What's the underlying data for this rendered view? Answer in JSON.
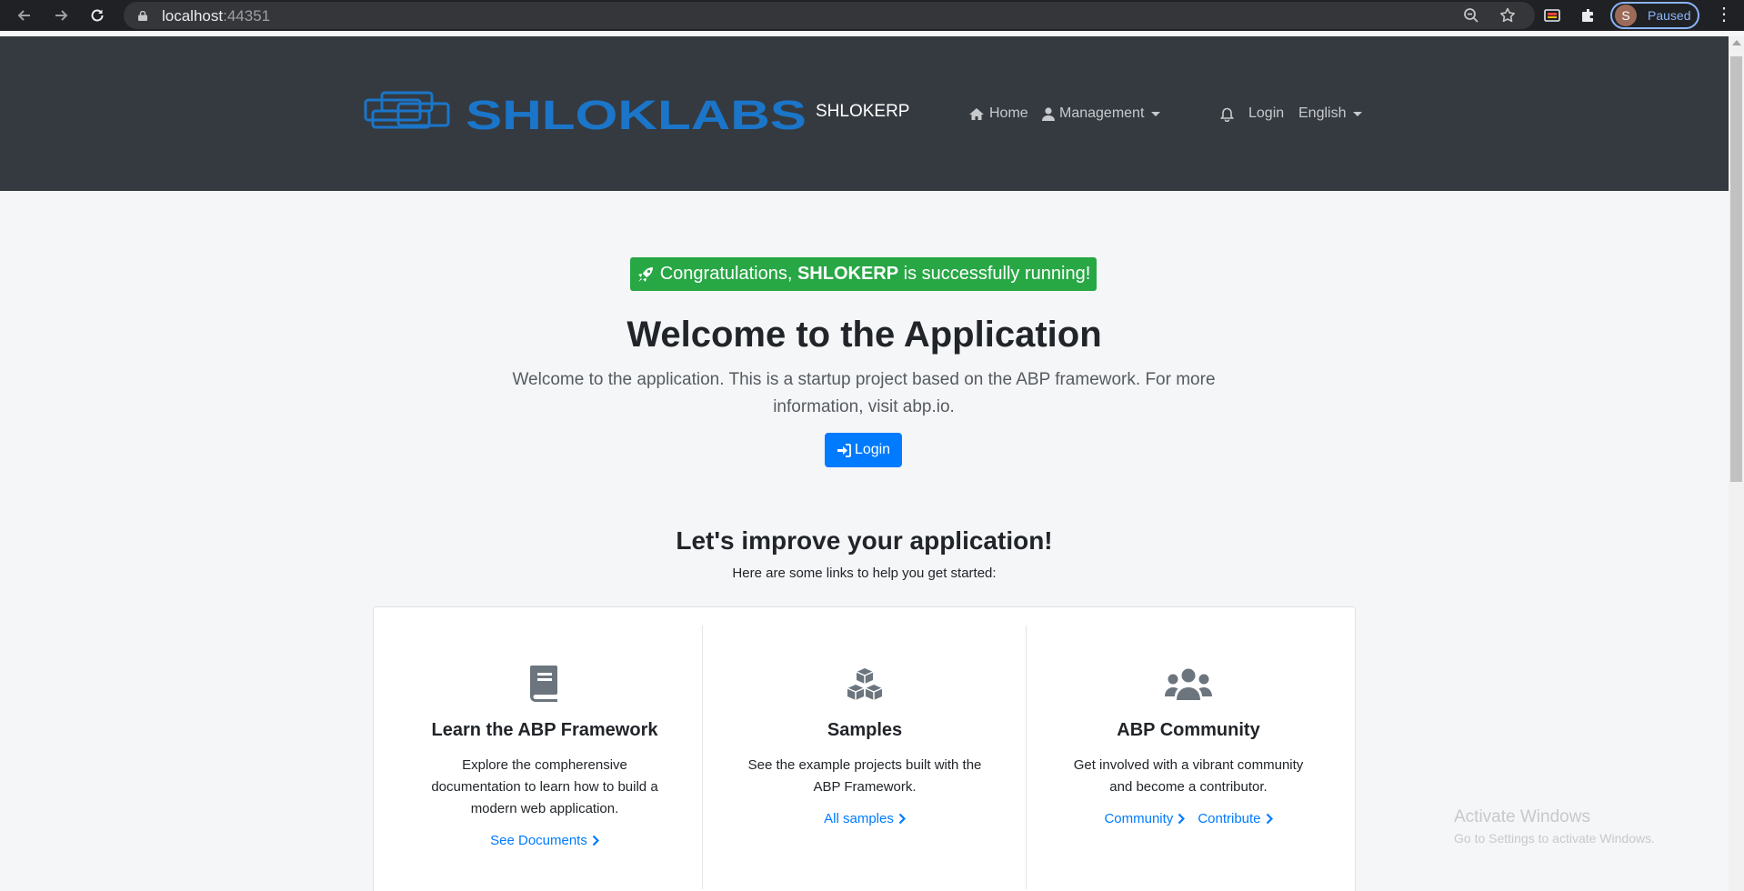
{
  "browser": {
    "url_host": "localhost",
    "url_port": ":44351",
    "profile_initial": "S",
    "profile_status": "Paused"
  },
  "header": {
    "logo_text": "SHLOKLABS",
    "brand": "SHLOKERP",
    "nav": {
      "home": "Home",
      "management": "Management",
      "login": "Login",
      "language": "English"
    }
  },
  "hero": {
    "congrats_prefix": "Congratulations, ",
    "app_name": "SHLOKERP",
    "congrats_suffix": " is successfully running!",
    "title": "Welcome to the Application",
    "lead_line1": "Welcome to the application. This is a startup project based on the ABP framework. For more",
    "lead_line2": "information, visit abp.io.",
    "login_button": "Login"
  },
  "improve": {
    "title": "Let's improve your application!",
    "subtitle": "Here are some links to help you get started:"
  },
  "features": [
    {
      "title": "Learn the ABP Framework",
      "desc1": "Explore the compherensive",
      "desc2": "documentation to learn how to build a",
      "desc3": "modern web application.",
      "link": "See Documents"
    },
    {
      "title": "Samples",
      "desc1": "See the example projects built with the",
      "desc2": "ABP Framework.",
      "link": "All samples"
    },
    {
      "title": "ABP Community",
      "desc1": "Get involved with a vibrant community",
      "desc2": "and become a contributor.",
      "link1": "Community",
      "link2": "Contribute"
    }
  ],
  "watermark": {
    "line1": "Activate Windows",
    "line2": "Go to Settings to activate Windows."
  },
  "colors": {
    "header_bg": "#343a40",
    "success": "#28a745",
    "primary": "#007bff",
    "logo_blue": "#1b75c9"
  },
  "icons": [
    "back-icon",
    "forward-icon",
    "reload-icon",
    "lock-icon",
    "zoom-icon",
    "star-icon",
    "cast-icon",
    "extensions-icon",
    "kebab-menu-icon",
    "home-icon",
    "user-icon",
    "bell-icon",
    "rocket-icon",
    "sign-in-icon",
    "book-icon",
    "cubes-icon",
    "users-icon",
    "chevron-right-icon"
  ]
}
